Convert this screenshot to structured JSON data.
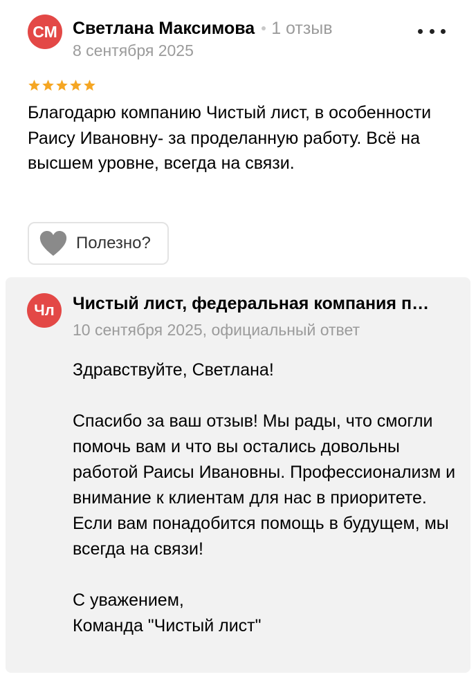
{
  "review": {
    "author_initials": "СМ",
    "author_name": "Светлана Максимова",
    "review_count": "1 отзыв",
    "date": "8 сентября 2025",
    "rating": 5,
    "text": "Благодарю компанию Чистый лист, в особенности Раису Ивановну- за проделанную работу. Всё на высшем уровне, всегда на связи.",
    "helpful_label": "Полезно?",
    "more_icon": "more-dots-icon",
    "star_color": "#f5a623",
    "avatar_color": "#e34846"
  },
  "answer": {
    "company_initials": "Чл",
    "company_name": "Чистый лист, федеральная компания п…",
    "meta": "10 сентября 2025, официальный ответ",
    "paragraphs": {
      "greeting": "Здравствуйте, Светлана!",
      "body": "Спасибо за ваш отзыв! Мы рады, что смогли помочь вам и что вы остались довольны работой Раисы Ивановны. Профессионализм и внимание к клиентам для нас в приоритете. Если вам понадобится помощь в будущем, мы всегда на связи!",
      "sign_1": "С уважением,",
      "sign_2": "Команда \"Чистый лист\""
    },
    "background_color": "#f2f2f2"
  }
}
